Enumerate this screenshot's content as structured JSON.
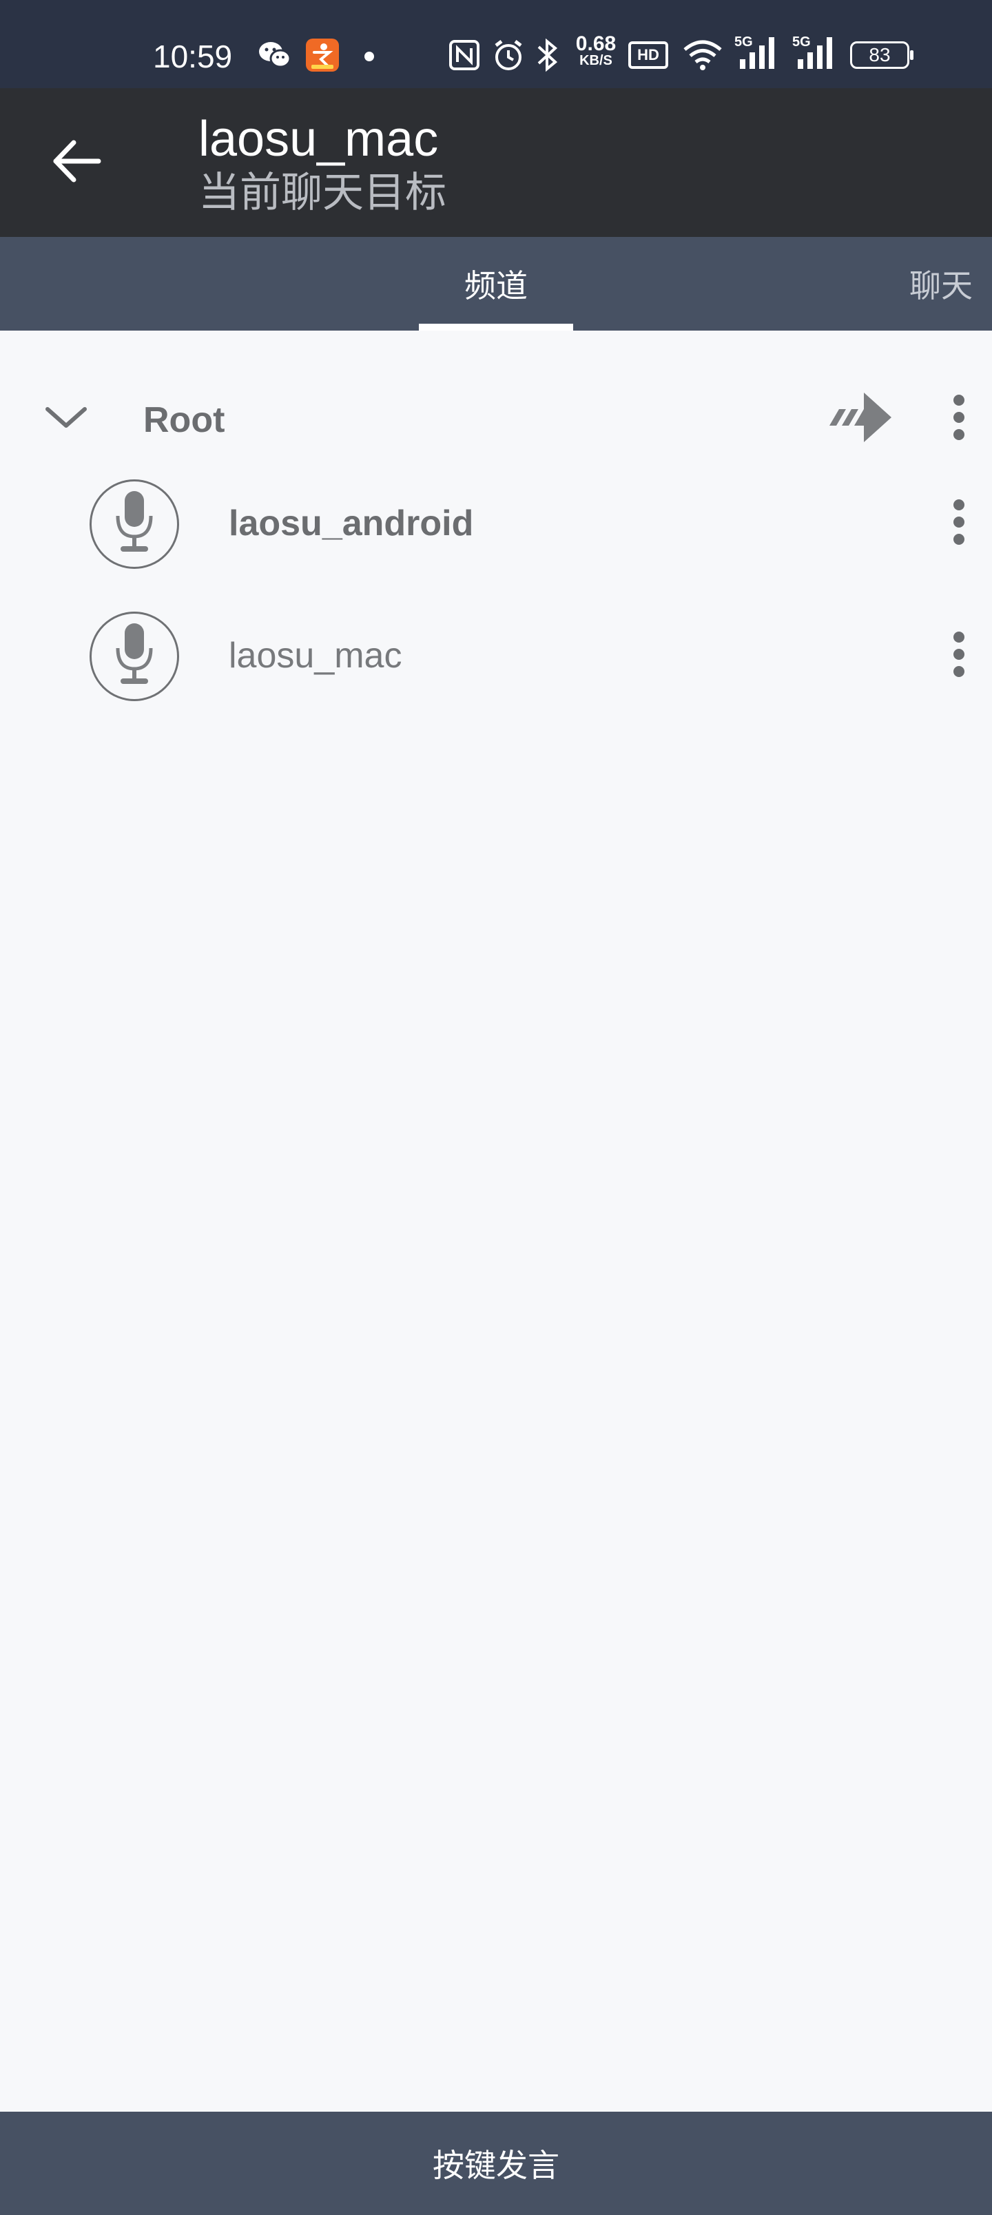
{
  "status_bar": {
    "time": "10:59",
    "net_speed": "0.68",
    "net_speed_unit": "KB/S",
    "hd_label": "HD",
    "signal1_label": "5G",
    "signal2_label": "5G",
    "battery": "83",
    "icons": [
      "wechat-icon",
      "app-notification-icon",
      "dot-icon",
      "nfc-icon",
      "alarm-icon",
      "bluetooth-icon",
      "hd-icon",
      "wifi-icon",
      "signal-icon",
      "signal-icon",
      "battery-icon"
    ]
  },
  "app_bar": {
    "title": "laosu_mac",
    "subtitle": "当前聊天目标",
    "back_icon": "arrow-left-icon"
  },
  "tabs": [
    {
      "label": "频道",
      "selected": true
    },
    {
      "label": "聊天",
      "selected": false
    }
  ],
  "channel_tree": {
    "root": {
      "label": "Root",
      "expanded": true,
      "icons": [
        "chevron-down-icon",
        "join-arrow-icon",
        "more-vert-icon"
      ]
    },
    "users": [
      {
        "name": "laosu_android",
        "bold": true,
        "icon": "microphone-icon"
      },
      {
        "name": "laosu_mac",
        "bold": false,
        "icon": "microphone-icon"
      }
    ]
  },
  "ptt": {
    "label": "按键发言"
  },
  "colors": {
    "status_bar": "#2b3345",
    "app_bar": "#2d2f33",
    "tab_bar": "#475163",
    "content_bg": "#f7f8fa",
    "text_gray": "#6b6d70"
  }
}
